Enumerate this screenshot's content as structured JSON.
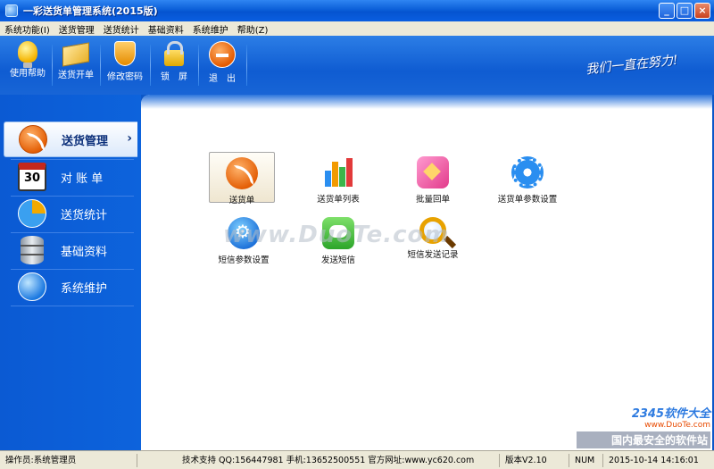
{
  "window": {
    "title": "一彩送货单管理系统(2015版)"
  },
  "window_controls": {
    "minimize": "_",
    "maximize": "□",
    "close": "×"
  },
  "menubar": [
    "系统功能(I)",
    "送货管理",
    "送货统计",
    "基础资料",
    "系统维护",
    "帮助(Z)"
  ],
  "toolbar": {
    "items": [
      {
        "label": "使用帮助",
        "icon": "lightbulb-icon"
      },
      {
        "label": "送货开单",
        "icon": "box-icon"
      },
      {
        "label": "修改密码",
        "icon": "shield-icon"
      },
      {
        "label": "锁　屏",
        "icon": "lock-icon"
      },
      {
        "label": "退　出",
        "icon": "exit-icon"
      }
    ],
    "slogan": "我们一直在努力!"
  },
  "sidebar": {
    "items": [
      {
        "label": "送货管理",
        "icon": "rss-icon",
        "active": true
      },
      {
        "label": "对 账 单",
        "icon": "calendar-icon",
        "calendar_day": "30"
      },
      {
        "label": "送货统计",
        "icon": "pie-chart-icon"
      },
      {
        "label": "基础资料",
        "icon": "database-icon"
      },
      {
        "label": "系统维护",
        "icon": "globe-icon"
      }
    ],
    "active_chevron": "›"
  },
  "tiles": [
    {
      "label": "送货单",
      "icon": "rss-icon",
      "selected": true
    },
    {
      "label": "送货单列表",
      "icon": "bar-chart-icon"
    },
    {
      "label": "批量回单",
      "icon": "layers-icon"
    },
    {
      "label": "送货单参数设置",
      "icon": "gear-icon"
    },
    {
      "label": "短信参数设置",
      "icon": "sms-settings-icon"
    },
    {
      "label": "发送短信",
      "icon": "chat-icon"
    },
    {
      "label": "短信发送记录",
      "icon": "magnifier-icon"
    }
  ],
  "watermark": "www.DuoTe.com",
  "corner_logo": {
    "brand": "2345软件大全",
    "url": "www.DuoTe.com",
    "tagline": "国内最安全的软件站"
  },
  "statusbar": {
    "operator": "操作员:系统管理员",
    "support": "技术支持 QQ:156447981 手机:13652500551 官方网址:www.yc620.com",
    "version": "版本V2.10",
    "numlock": "NUM",
    "datetime": "2015-10-14 14:16:01"
  },
  "colors": {
    "title_blue": "#0b5fd8",
    "sidebar_blue": "#0b5ad3",
    "accent_orange": "#e25a00",
    "status_bg": "#ece9d8"
  }
}
